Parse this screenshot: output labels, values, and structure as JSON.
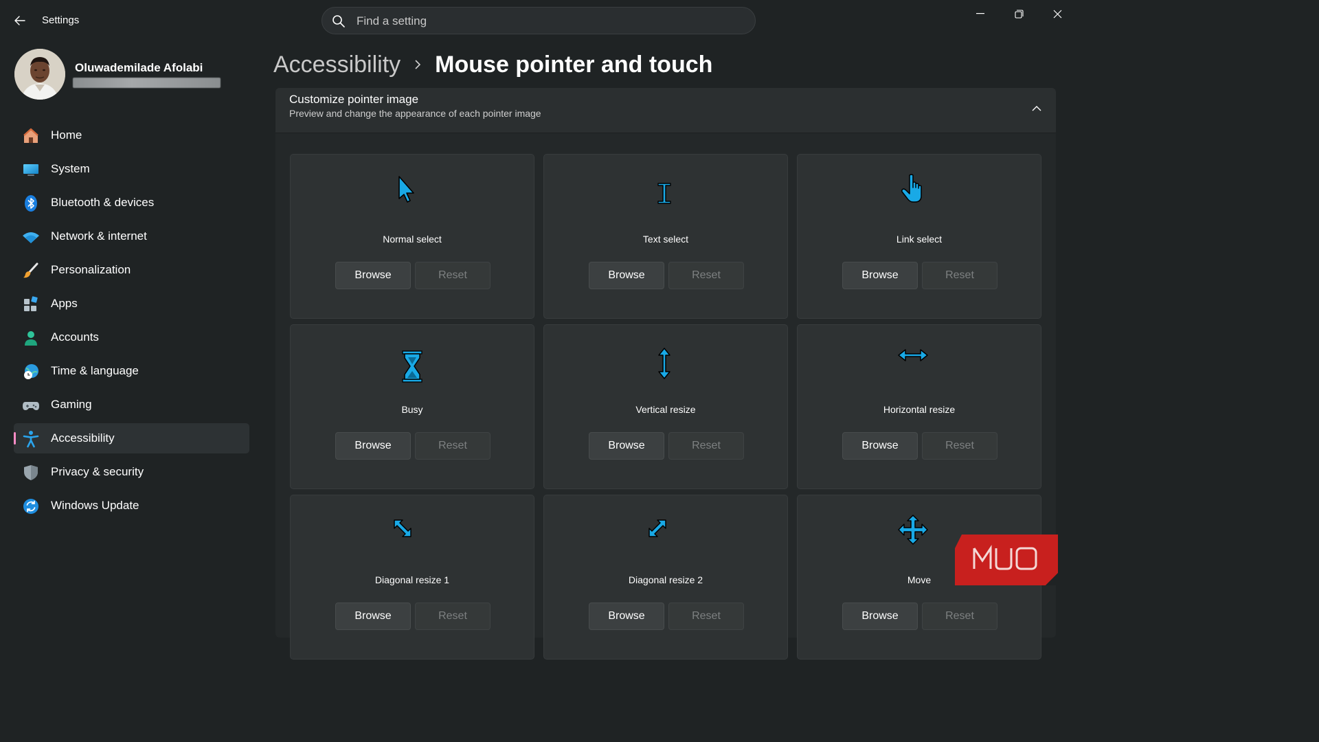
{
  "app": {
    "title": "Settings"
  },
  "search": {
    "placeholder": "Find a setting"
  },
  "user": {
    "name": "Oluwademilade Afolabi"
  },
  "nav": {
    "items": [
      {
        "label": "Home",
        "icon": "home-icon"
      },
      {
        "label": "System",
        "icon": "system-icon"
      },
      {
        "label": "Bluetooth & devices",
        "icon": "bluetooth-icon"
      },
      {
        "label": "Network & internet",
        "icon": "wifi-icon"
      },
      {
        "label": "Personalization",
        "icon": "brush-icon"
      },
      {
        "label": "Apps",
        "icon": "apps-icon"
      },
      {
        "label": "Accounts",
        "icon": "account-icon"
      },
      {
        "label": "Time & language",
        "icon": "globe-clock-icon"
      },
      {
        "label": "Gaming",
        "icon": "gamepad-icon"
      },
      {
        "label": "Accessibility",
        "icon": "accessibility-icon",
        "active": true
      },
      {
        "label": "Privacy & security",
        "icon": "shield-icon"
      },
      {
        "label": "Windows Update",
        "icon": "update-icon"
      }
    ]
  },
  "header": {
    "parent": "Accessibility",
    "title": "Mouse pointer and touch"
  },
  "section": {
    "title": "Customize pointer image",
    "subtitle": "Preview and change the appearance of each pointer image"
  },
  "pointers": [
    {
      "label": "Normal select",
      "icon": "arrow-pointer-icon",
      "browse": "Browse",
      "reset": "Reset"
    },
    {
      "label": "Text select",
      "icon": "text-beam-icon",
      "browse": "Browse",
      "reset": "Reset"
    },
    {
      "label": "Link select",
      "icon": "hand-pointer-icon",
      "browse": "Browse",
      "reset": "Reset"
    },
    {
      "label": "Busy",
      "icon": "hourglass-icon",
      "browse": "Browse",
      "reset": "Reset"
    },
    {
      "label": "Vertical resize",
      "icon": "vertical-resize-icon",
      "browse": "Browse",
      "reset": "Reset"
    },
    {
      "label": "Horizontal resize",
      "icon": "horizontal-resize-icon",
      "browse": "Browse",
      "reset": "Reset"
    },
    {
      "label": "Diagonal resize 1",
      "icon": "diagonal-resize-1-icon",
      "browse": "Browse",
      "reset": "Reset"
    },
    {
      "label": "Diagonal resize 2",
      "icon": "diagonal-resize-2-icon",
      "browse": "Browse",
      "reset": "Reset"
    },
    {
      "label": "Move",
      "icon": "move-icon",
      "browse": "Browse",
      "reset": "Reset"
    }
  ],
  "watermark": {
    "text": "MUO"
  },
  "colors": {
    "accent": "#19a9e6",
    "active_indicator": "#ff8cc6",
    "background": "#1f2324"
  }
}
